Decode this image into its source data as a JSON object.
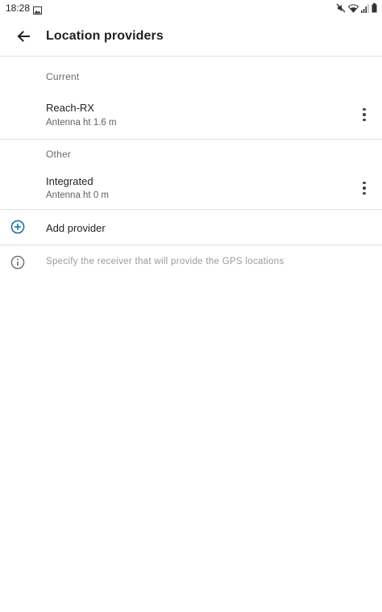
{
  "status_bar": {
    "time": "18:28",
    "icons": [
      "photo-icon",
      "mute-icon",
      "wifi-icon",
      "signal-icon",
      "battery-icon"
    ]
  },
  "app_bar": {
    "title": "Location providers",
    "back_icon": "arrow-back-icon"
  },
  "sections": {
    "current": {
      "label": "Current",
      "provider": {
        "name": "Reach-RX",
        "detail": "Antenna ht 1.6 m"
      }
    },
    "other": {
      "label": "Other",
      "provider": {
        "name": "Integrated",
        "detail": "Antenna ht 0 m"
      }
    }
  },
  "add_provider": {
    "label": "Add provider",
    "icon": "add-circle-icon",
    "accent": "#1a73a8"
  },
  "info": {
    "text": "Specify the receiver that will provide the GPS locations",
    "icon": "info-icon"
  }
}
